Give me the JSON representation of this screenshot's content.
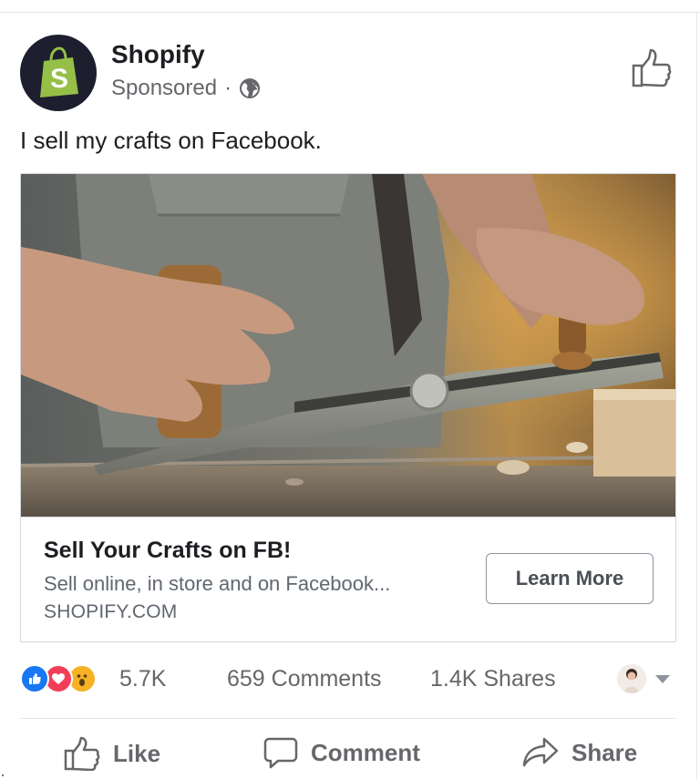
{
  "post": {
    "page_name": "Shopify",
    "sponsored_label": "Sponsored",
    "separator": "·",
    "text": "I sell my crafts on Facebook."
  },
  "ad": {
    "headline": "Sell Your Crafts on FB!",
    "description": "Sell online, in store and on Facebook...",
    "domain": "SHOPIFY.COM",
    "cta_label": "Learn More"
  },
  "stats": {
    "reactions_count": "5.7K",
    "comments": "659 Comments",
    "shares": "1.4K Shares",
    "reaction_icons": [
      "like-reaction-icon",
      "love-reaction-icon",
      "wow-reaction-icon"
    ]
  },
  "actions": {
    "like_label": "Like",
    "comment_label": "Comment",
    "share_label": "Share"
  },
  "colors": {
    "brand_green": "#95bf47",
    "facebook_blue": "#1877f2",
    "muted_text": "#65676b"
  }
}
